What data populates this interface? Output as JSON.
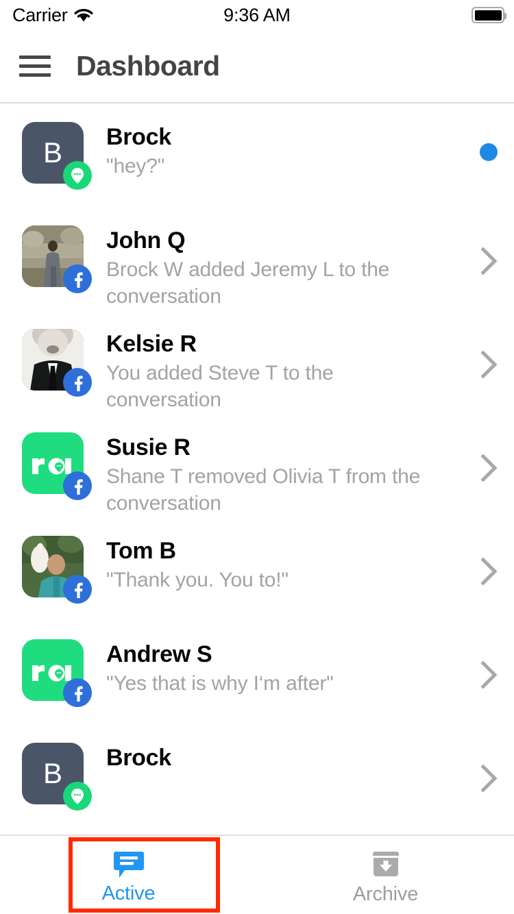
{
  "status_bar": {
    "carrier": "Carrier",
    "wifi_icon": "wifi-icon",
    "time": "9:36 AM",
    "battery_icon": "battery-full-icon"
  },
  "nav_bar": {
    "menu_icon": "hamburger-menu-icon",
    "title": "Dashboard"
  },
  "conversations": [
    {
      "name": "Brock",
      "preview": "\"hey?\"",
      "avatar_type": "initial",
      "avatar_initial": "B",
      "avatar_color": "#4a5568",
      "badge": "messenger-bubble-icon",
      "accessory": "unread-dot",
      "unread": true
    },
    {
      "name": "John Q",
      "preview": "Brock W added Jeremy L to the conversation",
      "avatar_type": "photo",
      "avatar_photo": "man-standing-outdoors-photo",
      "badge": "facebook-icon",
      "accessory": "chevron-right-icon",
      "unread": false
    },
    {
      "name": "Kelsie R",
      "preview": "You added Steve T to the conversation",
      "avatar_type": "photo",
      "avatar_photo": "man-in-suit-bw-photo",
      "badge": "facebook-icon",
      "accessory": "chevron-right-icon",
      "unread": false
    },
    {
      "name": "Susie R",
      "preview": "Shane T removed Olivia T from the conversation",
      "avatar_type": "brand",
      "avatar_logo": "ra",
      "avatar_color": "#1fdd7f",
      "badge": "facebook-icon",
      "accessory": "chevron-right-icon",
      "unread": false
    },
    {
      "name": "Tom B",
      "preview": "\"Thank you. You to!\"",
      "avatar_type": "photo",
      "avatar_photo": "man-with-cockatoo-photo",
      "badge": "facebook-icon",
      "accessory": "chevron-right-icon",
      "unread": false
    },
    {
      "name": "Andrew S",
      "preview": "\"Yes that is why I‘m after\"",
      "avatar_type": "brand",
      "avatar_logo": "ra",
      "avatar_color": "#1fdd7f",
      "badge": "facebook-icon",
      "accessory": "chevron-right-icon",
      "unread": false
    },
    {
      "name": "Brock",
      "preview": "",
      "avatar_type": "initial",
      "avatar_initial": "B",
      "avatar_color": "#4a5568",
      "badge": "messenger-bubble-icon",
      "accessory": "chevron-right-icon",
      "unread": false
    }
  ],
  "tab_bar": {
    "tabs": [
      {
        "label": "Active",
        "icon": "chat-bubble-lines-icon",
        "selected": true,
        "color": "#2196f3"
      },
      {
        "label": "Archive",
        "icon": "archive-box-down-arrow-icon",
        "selected": false,
        "color": "#9e9e9e"
      }
    ]
  },
  "annotation": {
    "highlight_color": "#ff2a00",
    "target": "Active"
  }
}
